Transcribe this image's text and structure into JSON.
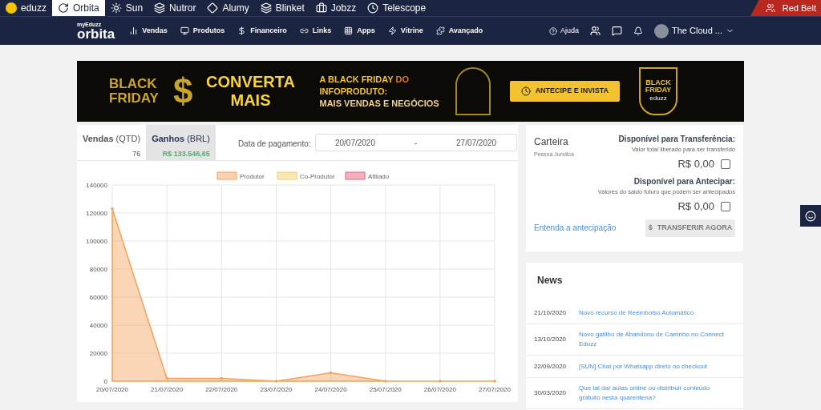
{
  "top_bar": {
    "apps": [
      {
        "label": "eduzz",
        "kind": "logo",
        "selected": false
      },
      {
        "label": "Orbita",
        "kind": "ring",
        "selected": true
      },
      {
        "label": "Sun",
        "kind": "sun",
        "selected": false
      },
      {
        "label": "Nutror",
        "kind": "nutror",
        "selected": false
      },
      {
        "label": "Alumy",
        "kind": "diamond",
        "selected": false
      },
      {
        "label": "Blinket",
        "kind": "blinket",
        "selected": false
      },
      {
        "label": "Jobzz",
        "kind": "jobzz",
        "selected": false
      },
      {
        "label": "Telescope",
        "kind": "clock",
        "selected": false
      }
    ],
    "belt": "Red Belt"
  },
  "nav": {
    "brand_small": "myEduzz",
    "brand": "orbita",
    "items": [
      {
        "label": "Vendas"
      },
      {
        "label": "Produtos"
      },
      {
        "label": "Financeiro"
      },
      {
        "label": "Links"
      },
      {
        "label": "Apps"
      },
      {
        "label": "Vitrine"
      },
      {
        "label": "Avançado"
      }
    ],
    "help": "Ajuda",
    "user": "The Cloud ..."
  },
  "banner": {
    "left_title": "BLACK FRIDAY",
    "symbol": "$",
    "headline": "CONVERTA MAIS",
    "text_1": "A BLACK FRIDAY",
    "text_2": "DO",
    "text_3": "INFOPRODUTO:",
    "text_4": "MAIS VENDAS E NEGÓCIOS",
    "button": "ANTECIPE E INVISTA",
    "badge_title": "BLACK FRIDAY",
    "badge_brand": "eduzz"
  },
  "stats": {
    "tabs": [
      {
        "label": "Vendas",
        "unit": "(QTD)",
        "value": "76",
        "selected": false
      },
      {
        "label": "Ganhos",
        "unit": "(BRL)",
        "value": "R$ 133.546,65",
        "selected": true
      }
    ],
    "date_label": "Data de pagamento:",
    "date_from": "20/07/2020",
    "date_sep": "-",
    "date_to": "27/07/2020",
    "chart_data": {
      "type": "area",
      "grid": true,
      "categories": [
        "20/07/2020",
        "21/07/2020",
        "22/07/2020",
        "23/07/2020",
        "24/07/2020",
        "25/07/2020",
        "26/07/2020",
        "27/07/2020"
      ],
      "ylim": [
        0,
        140000
      ],
      "yticks": [
        0,
        20000,
        40000,
        60000,
        80000,
        100000,
        120000,
        140000
      ],
      "series": [
        {
          "name": "Produtor",
          "color": "#f5a25d",
          "values": [
            123000,
            2000,
            2000,
            0,
            6000,
            0,
            0,
            0
          ]
        },
        {
          "name": "Co-Produtor",
          "color": "#f7cf6b",
          "values": [
            null,
            null,
            null,
            null,
            null,
            null,
            null,
            null
          ]
        },
        {
          "name": "Afiliado",
          "color": "#e9627a",
          "values": [
            null,
            null,
            null,
            null,
            null,
            null,
            null,
            null
          ]
        }
      ]
    }
  },
  "wallet": {
    "title": "Carteira",
    "subtitle": "Pessoa Jurídica",
    "sections": [
      {
        "title": "Disponível para Transferência:",
        "hint": "Valor total liberado para ser transferido",
        "amount": "R$ 0,00",
        "checked": false
      },
      {
        "title": "Disponível para Antecipar:",
        "hint": "Valores do saldo futuro que podem ser antecipados",
        "amount": "R$ 0,00",
        "checked": false
      }
    ],
    "link": "Entenda a antecipação",
    "button_icon": "$",
    "button": "TRANSFERIR AGORA",
    "button_disabled": true
  },
  "news": {
    "title": "News",
    "items": [
      {
        "date": "21/10/2020",
        "text": "Novo recurso de Reembolso Automático"
      },
      {
        "date": "13/10/2020",
        "text": "Novo gatilho de Abandono de Carrinho no Connect Eduzz"
      },
      {
        "date": "22/09/2020",
        "text": "[SUN] Chat por Whatsapp direto no checkout"
      },
      {
        "date": "30/03/2020",
        "text": "Que tal dar aulas online ou distribuir conteúdo gratuito nesta quarentena?"
      }
    ]
  }
}
